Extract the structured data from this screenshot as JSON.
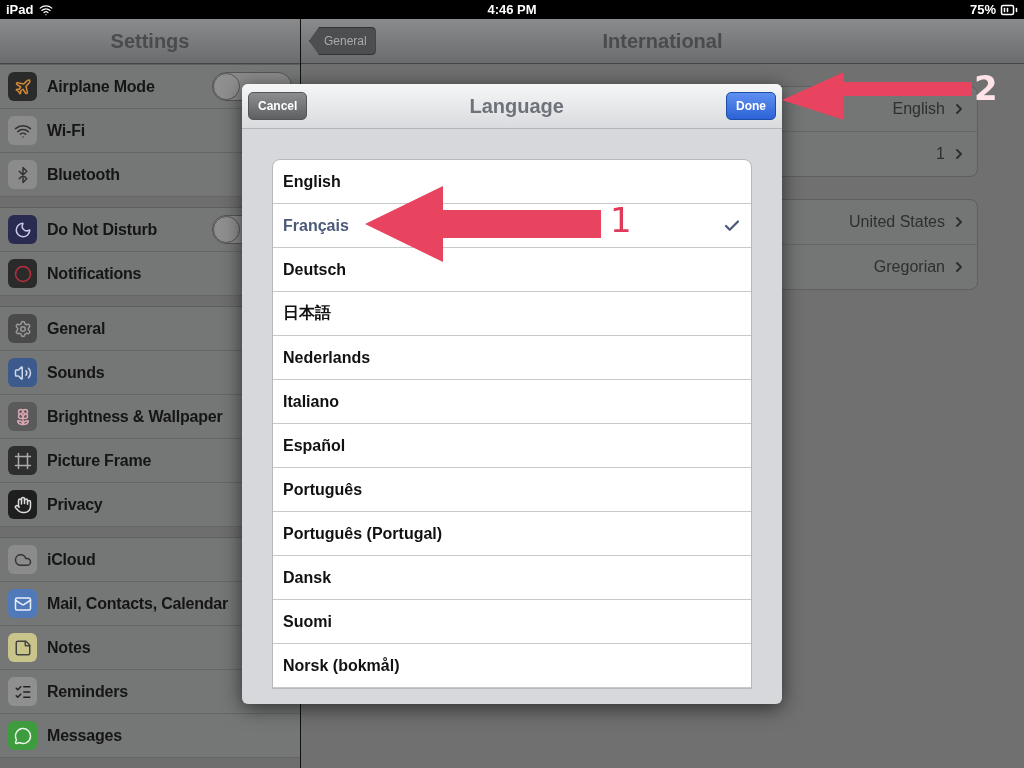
{
  "status_bar": {
    "device": "iPad",
    "time": "4:46 PM",
    "battery": "75%"
  },
  "sidebar": {
    "title": "Settings",
    "groups": [
      [
        {
          "label": "Airplane Mode",
          "toggle": {
            "on": false
          }
        },
        {
          "label": "Wi-Fi"
        },
        {
          "label": "Bluetooth"
        }
      ],
      [
        {
          "label": "Do Not Disturb",
          "toggle": {
            "on": false
          }
        },
        {
          "label": "Notifications"
        }
      ],
      [
        {
          "label": "General"
        },
        {
          "label": "Sounds"
        },
        {
          "label": "Brightness & Wallpaper"
        },
        {
          "label": "Picture Frame"
        },
        {
          "label": "Privacy"
        }
      ],
      [
        {
          "label": "iCloud"
        },
        {
          "label": "Mail, Contacts, Calendar"
        },
        {
          "label": "Notes"
        },
        {
          "label": "Reminders"
        },
        {
          "label": "Messages"
        }
      ]
    ]
  },
  "detail": {
    "back_button": "General",
    "title": "International",
    "groups": [
      [
        {
          "value": "English"
        },
        {
          "value": "1"
        }
      ],
      [
        {
          "value": "United States"
        },
        {
          "value": "Gregorian"
        }
      ]
    ]
  },
  "dialog": {
    "cancel_button": "Cancel",
    "title": "Language",
    "done_button": "Done",
    "options": [
      {
        "label": "English",
        "selected": false
      },
      {
        "label": "Français",
        "selected": true
      },
      {
        "label": "Deutsch",
        "selected": false
      },
      {
        "label": "日本語",
        "selected": false
      },
      {
        "label": "Nederlands",
        "selected": false
      },
      {
        "label": "Italiano",
        "selected": false
      },
      {
        "label": "Español",
        "selected": false
      },
      {
        "label": "Português",
        "selected": false
      },
      {
        "label": "Português (Portugal)",
        "selected": false
      },
      {
        "label": "Dansk",
        "selected": false
      },
      {
        "label": "Suomi",
        "selected": false
      },
      {
        "label": "Norsk (bokmål)",
        "selected": false
      }
    ]
  },
  "annotations": [
    {
      "label": "1"
    },
    {
      "label": "2"
    }
  ]
}
